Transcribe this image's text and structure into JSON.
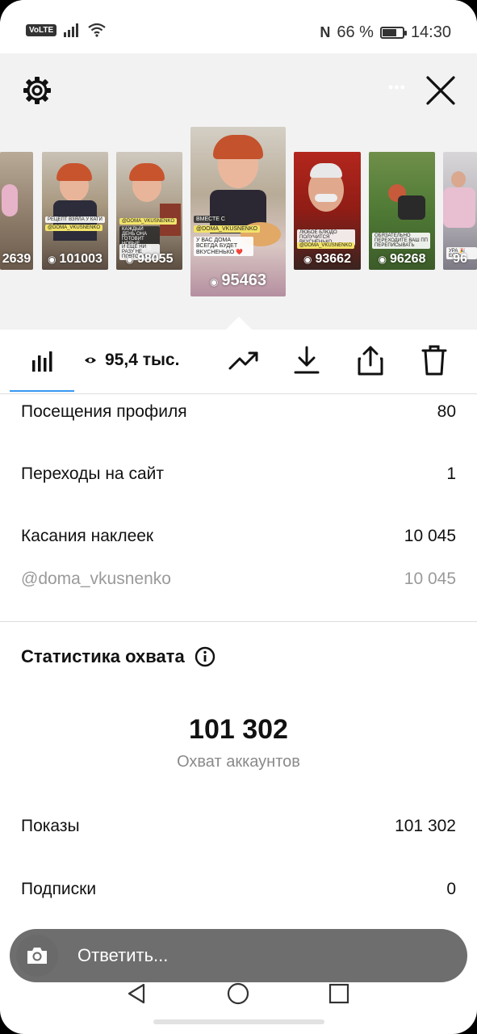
{
  "status_bar": {
    "carrier_badge": "VoLTE",
    "nfc": "N",
    "battery": "66 %",
    "battery_level": 0.66,
    "time": "14:30"
  },
  "thumbnails": [
    {
      "count": "2639",
      "tags": []
    },
    {
      "count": "101003",
      "tags": [
        "РЕЦЕПТ ВЗЯЛА У КАТИ",
        "@DOMA_VKUSNENKO"
      ]
    },
    {
      "count": "98055",
      "tags": [
        "@DOMA_VKUSNENKO",
        "КАЖДЫЙ ДЕНЬ ОНА ГОТОВИТ НОВЫЕ ЗАВТРАКИ В СТОРИЗ",
        "И ЕЩЁ НИ РАЗУ НЕ ПОВТОРИЛАСЬ"
      ]
    },
    {
      "count": "95463",
      "tags": [
        "ВМЕСТЕ С",
        "@DOMA_VKUSNENKO",
        "У ВАС ДОМА ВСЕГДА БУДЕТ ВКУСНЕНЬКО ❤️"
      ]
    },
    {
      "count": "93662",
      "tags": [
        "ЛЮБОЕ БЛЮДО ПОЛУЧИТСЯ ВКУСНЕНЬКО",
        "@DOMA_VKUSNENKO"
      ]
    },
    {
      "count": "96268",
      "tags": [
        "ОБЯЗАТЕЛЬНО ПЕРЕХОДИТЕ ВАШ ПП ПЕРЕПИСЫВАТЬ"
      ]
    },
    {
      "count": "96",
      "tags": [
        "УРА 🎉 ЕСТЬ"
      ]
    }
  ],
  "toolbar": {
    "views": "95,4 тыс."
  },
  "stats": {
    "profile_visits_label": "Посещения профиля",
    "profile_visits": "80",
    "website_clicks_label": "Переходы на сайт",
    "website_clicks": "1",
    "sticker_taps_label": "Касания наклеек",
    "sticker_taps": "10 045",
    "sticker_handle": "@doma_vkusnenko",
    "sticker_handle_value": "10 045"
  },
  "reach": {
    "title": "Статистика охвата",
    "value": "101 302",
    "label": "Охват аккаунтов",
    "impressions_label": "Показы",
    "impressions": "101 302",
    "follows_label": "Подписки",
    "follows": "0"
  },
  "reply": {
    "placeholder": "Ответить..."
  },
  "colors": {
    "accent": "#3897f0",
    "muted": "#9a9a9a"
  }
}
